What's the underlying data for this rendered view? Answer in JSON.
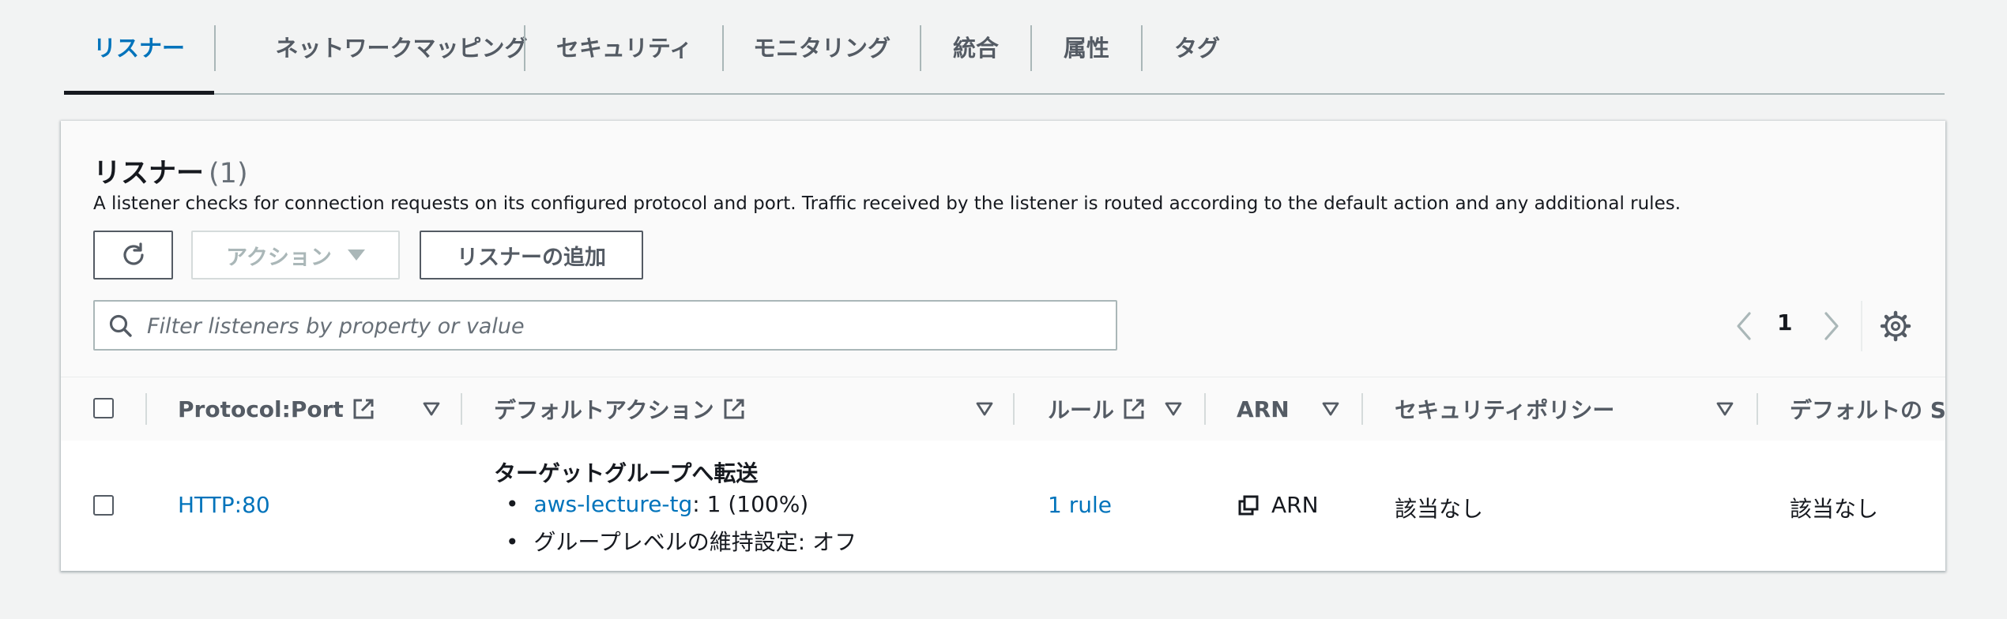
{
  "tabs": [
    {
      "label": "リスナー",
      "active": true
    },
    {
      "label": "ネットワークマッピング"
    },
    {
      "label": "セキュリティ"
    },
    {
      "label": "モニタリング"
    },
    {
      "label": "統合"
    },
    {
      "label": "属性"
    },
    {
      "label": "タグ"
    }
  ],
  "panel": {
    "title": "リスナー",
    "count": "(1)",
    "description": "A listener checks for connection requests on its configured protocol and port. Traffic received by the listener is routed according to the default action and any additional rules.",
    "refresh_icon": "refresh-icon",
    "actions_label": "アクション",
    "add_listener_label": "リスナーの追加",
    "search_placeholder": "Filter listeners by property or value",
    "page_number": "1"
  },
  "table": {
    "columns": [
      {
        "label": "Protocol:Port",
        "external": true
      },
      {
        "label": "デフォルトアクション",
        "external": true
      },
      {
        "label": "ルール",
        "external": true
      },
      {
        "label": "ARN",
        "external": false
      },
      {
        "label": "セキュリティポリシー",
        "external": false
      },
      {
        "label": "デフォルトの SS",
        "external": false
      }
    ],
    "rows": [
      {
        "protocol_port": "HTTP:80",
        "default_action_title": "ターゲットグループへ転送",
        "target_group_link": "aws-lecture-tg",
        "target_group_weight": ": 1 (100%)",
        "stickiness": "グループレベルの維持設定: オフ",
        "rules": "1 rule",
        "arn": "ARN",
        "security_policy": "該当なし",
        "default_ssl": "該当なし"
      }
    ]
  },
  "colors": {
    "link": "#0073bb",
    "text": "#16191f",
    "muted": "#545b64",
    "background": "#f2f3f3"
  }
}
